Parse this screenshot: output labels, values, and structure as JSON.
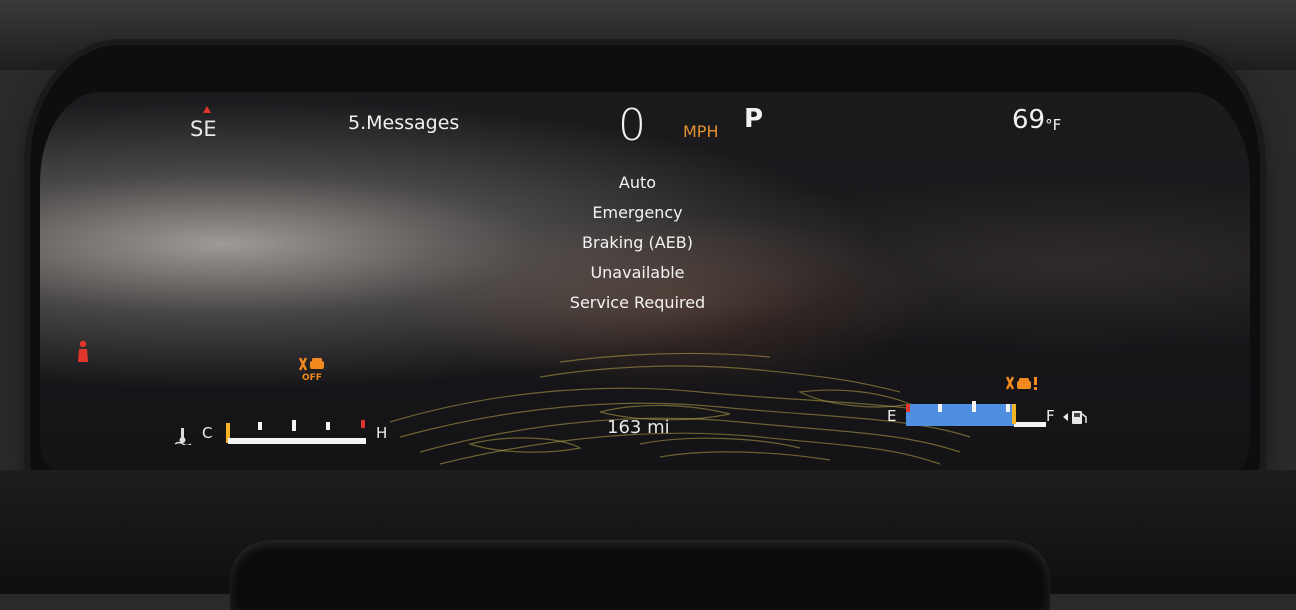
{
  "cluster": {
    "compass_heading": "SE",
    "menu_page": "5.Messages",
    "speed_value": "0",
    "speed_unit": "MPH",
    "gear": "P",
    "outside_temp": "69",
    "temp_unit": "°F",
    "message_lines": [
      "Auto",
      "Emergency",
      "Braking (AEB)",
      "Unavailable",
      "Service Required"
    ],
    "range": "163 mi",
    "coolant_gauge": {
      "low_label": "C",
      "high_label": "H",
      "level_fraction": 0.0
    },
    "fuel_gauge": {
      "empty_label": "E",
      "full_label": "F",
      "level_fraction": 0.65
    },
    "indicators": {
      "fcw_off_text": "OFF"
    }
  },
  "colors": {
    "accent_orange": "#e49132",
    "warning_orange": "#f08a1f",
    "fuel_blue": "#4f8fe0",
    "needle_yellow": "#f3b324",
    "compass_red": "#e0352b"
  },
  "icons": [
    "compass-marker-icon",
    "coolant-temp-icon",
    "forward-collision-off-icon",
    "collision-warning-icon",
    "fuel-pump-icon",
    "seatbelt-icon"
  ]
}
